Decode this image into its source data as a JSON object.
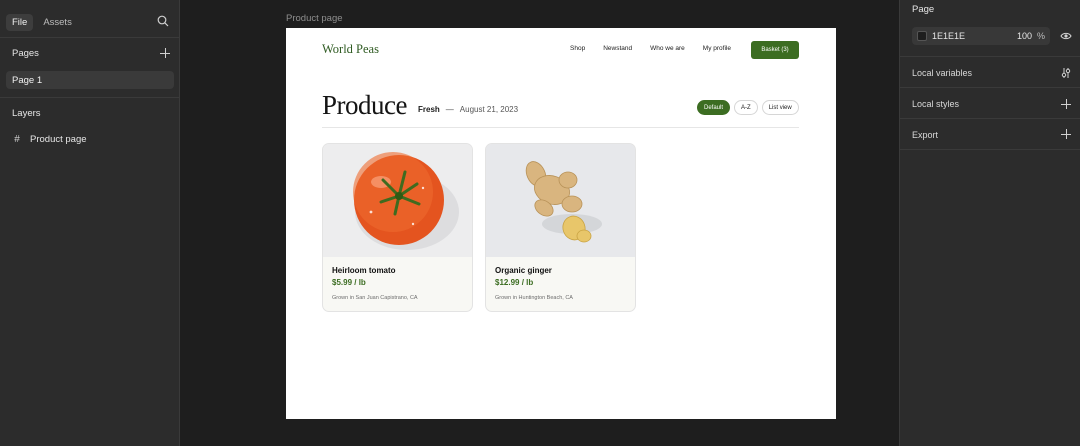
{
  "left_panel": {
    "tabs": [
      {
        "label": "File"
      },
      {
        "label": "Assets"
      }
    ],
    "pages_title": "Pages",
    "pages": [
      {
        "label": "Page 1"
      }
    ],
    "layers_title": "Layers",
    "layers": [
      {
        "label": "Product page"
      }
    ]
  },
  "canvas": {
    "frame_label": "Product page",
    "brand": "World Peas",
    "nav": [
      "Shop",
      "Newstand",
      "Who we are",
      "My profile"
    ],
    "basket_label": "Basket (3)",
    "heading": "Produce",
    "sub_label": "Fresh",
    "sub_dash": "—",
    "sub_date": "August 21, 2023",
    "chips": [
      {
        "label": "Default",
        "active": true
      },
      {
        "label": "A-Z",
        "active": false
      },
      {
        "label": "List view",
        "active": false
      }
    ],
    "products": [
      {
        "name": "Heirloom tomato",
        "price": "$5.99 / lb",
        "origin": "Grown in San Juan Capistrano, CA"
      },
      {
        "name": "Organic ginger",
        "price": "$12.99 / lb",
        "origin": "Grown in Huntington Beach, CA"
      }
    ]
  },
  "right_panel": {
    "page_title": "Page",
    "fill_hex": "1E1E1E",
    "fill_opacity": "100",
    "fill_unit": "%",
    "local_variables": "Local variables",
    "local_styles": "Local styles",
    "export": "Export"
  },
  "colors": {
    "canvas_bg": "#1e1e1e",
    "panel_bg": "#2c2c2c",
    "brand_green": "#3c6d22",
    "price_green": "#3c6d22"
  }
}
